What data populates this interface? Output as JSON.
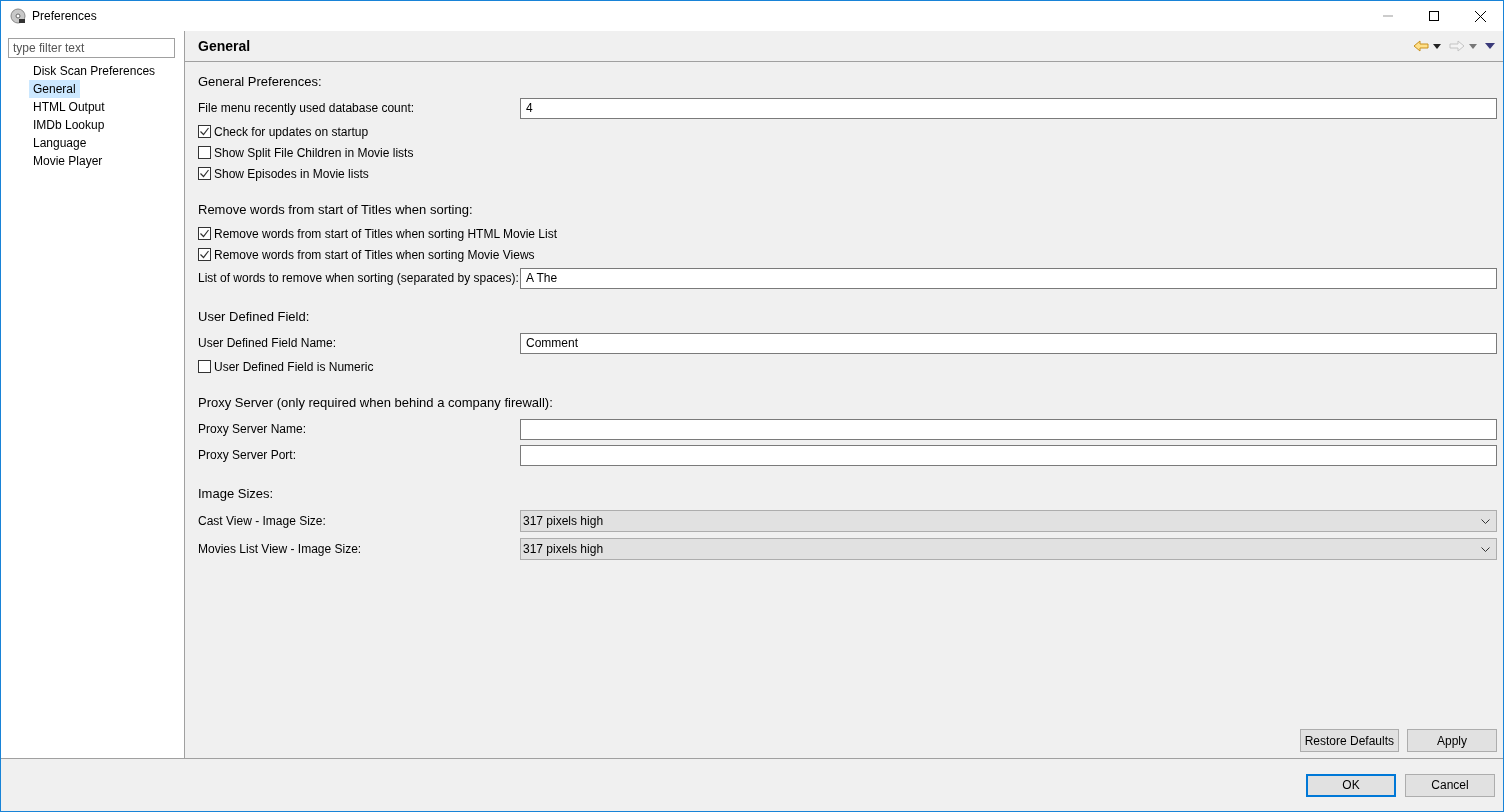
{
  "window": {
    "title": "Preferences"
  },
  "filter": {
    "placeholder": "type filter text"
  },
  "tree": [
    {
      "label": "Disk Scan Preferences",
      "selected": false
    },
    {
      "label": "General",
      "selected": true
    },
    {
      "label": "HTML Output",
      "selected": false
    },
    {
      "label": "IMDb Lookup",
      "selected": false
    },
    {
      "label": "Language",
      "selected": false
    },
    {
      "label": "Movie Player",
      "selected": false
    }
  ],
  "page": {
    "title": "General",
    "sections": [
      {
        "heading": "General Preferences:",
        "rows": [
          {
            "kind": "field",
            "label": "File menu recently used database count:",
            "value": "4"
          },
          {
            "kind": "checkbox",
            "label": "Check for updates on startup",
            "checked": true
          },
          {
            "kind": "checkbox",
            "label": "Show Split File Children in Movie lists",
            "checked": false
          },
          {
            "kind": "checkbox",
            "label": "Show Episodes in Movie lists",
            "checked": true
          }
        ]
      },
      {
        "heading": "Remove words from start of Titles when sorting:",
        "rows": [
          {
            "kind": "checkbox",
            "label": "Remove words from start of Titles when sorting HTML Movie List",
            "checked": true
          },
          {
            "kind": "checkbox",
            "label": "Remove words from start of Titles when sorting Movie Views",
            "checked": true
          },
          {
            "kind": "field",
            "label": "List of words to remove when sorting (separated by spaces):",
            "value": "A The"
          }
        ]
      },
      {
        "heading": "User Defined Field:",
        "rows": [
          {
            "kind": "field",
            "label": "User Defined Field Name:",
            "value": "Comment"
          },
          {
            "kind": "checkbox",
            "label": "User Defined Field is Numeric",
            "checked": false
          }
        ]
      },
      {
        "heading": "Proxy Server (only required when behind a company firewall):",
        "rows": [
          {
            "kind": "field",
            "label": "Proxy Server Name:"
          },
          {
            "kind": "field",
            "label": "Proxy Server Port:"
          }
        ]
      },
      {
        "heading": "Image Sizes:",
        "rows": [
          {
            "kind": "select",
            "label": "Cast View - Image Size:",
            "value": "317 pixels high"
          },
          {
            "kind": "select",
            "label": "Movies List View - Image Size:",
            "value": "317 pixels high"
          }
        ]
      }
    ],
    "buttons": [
      "Restore Defaults",
      "Apply"
    ]
  },
  "dialog_buttons": [
    {
      "label": "OK",
      "default": true
    },
    {
      "label": "Cancel",
      "default": false
    }
  ]
}
